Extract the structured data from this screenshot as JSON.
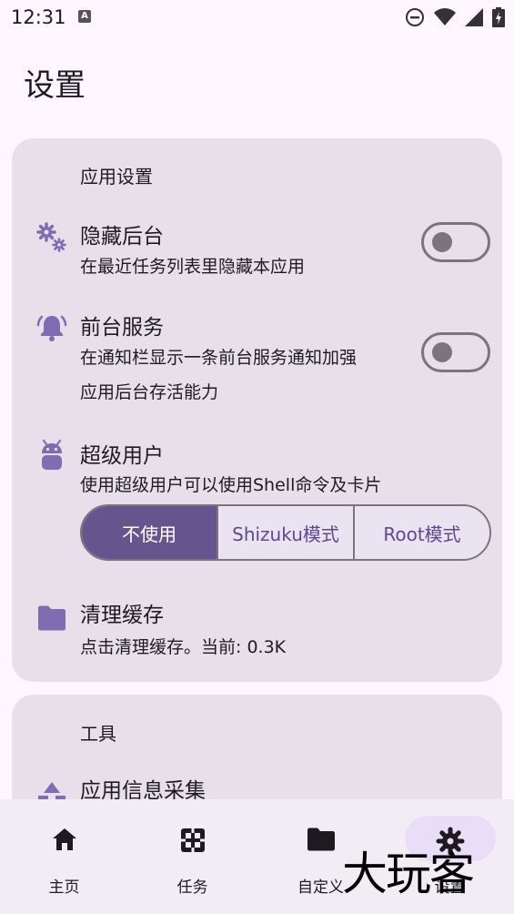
{
  "status_bar": {
    "time": "12:31",
    "notification_letter": "A"
  },
  "page": {
    "title": "设置"
  },
  "app_settings": {
    "header": "应用设置",
    "hide_background": {
      "title": "隐藏后台",
      "subtitle": "在最近任务列表里隐藏本应用",
      "enabled": false
    },
    "foreground_service": {
      "title": "前台服务",
      "subtitle_line1": "在通知栏显示一条前台服务通知加强",
      "subtitle_line2": "应用后台存活能力",
      "enabled": false
    },
    "super_user": {
      "title": "超级用户",
      "subtitle": "使用超级用户可以使用Shell命令及卡片",
      "options": [
        "不使用",
        "Shizuku模式",
        "Root模式"
      ],
      "selected": "不使用"
    },
    "clear_cache": {
      "title": "清理缓存",
      "subtitle": "点击清理缓存。当前: 0.3K"
    }
  },
  "tools": {
    "header": "工具",
    "app_info": {
      "title": "应用信息采集"
    }
  },
  "bottom_nav": {
    "items": [
      {
        "label": "主页",
        "icon": "home-icon"
      },
      {
        "label": "任务",
        "icon": "task-icon"
      },
      {
        "label": "自定义",
        "icon": "folder-icon"
      },
      {
        "label": "设置",
        "icon": "gear-icon"
      }
    ],
    "selected": "设置"
  },
  "watermark": "大玩客",
  "colors": {
    "accent": "#65558f",
    "icon": "#7e6db1",
    "card": "#e7e0eb",
    "background": "#fef7ff"
  }
}
